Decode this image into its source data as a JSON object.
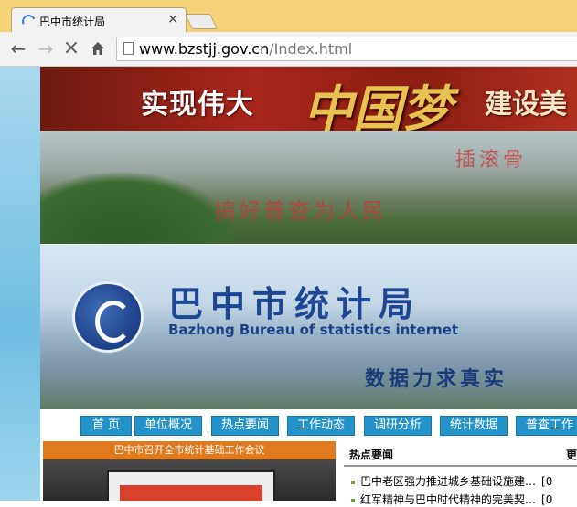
{
  "browser": {
    "tab_title": "巴中市统计局",
    "tab_close": "×",
    "url_host": "www.bzstjj.gov.cn",
    "url_path": "/Index.html"
  },
  "banner": {
    "slogan_left": "实现伟大",
    "slogan_dream": "中国梦",
    "slogan_right": "建设美",
    "calligraphy_right": "插滚骨",
    "calligraphy_left": "搞好普查为人民"
  },
  "header": {
    "title_cn": "巴中市统计局",
    "title_en": "Bazhong Bureau of statistics internet",
    "slogan": "数据力求真实"
  },
  "menu": {
    "items": [
      {
        "label": "首 页"
      },
      {
        "label": "单位概况"
      },
      {
        "label": "热点要闻"
      },
      {
        "label": "工作动态"
      },
      {
        "label": "调研分析"
      },
      {
        "label": "统计数据"
      },
      {
        "label": "普查工作"
      }
    ]
  },
  "news_photo": {
    "caption": "巴中市召开全市统计基础工作会议"
  },
  "hot_news": {
    "title": "热点要闻",
    "more": "更",
    "items": [
      {
        "text": "巴中老区强力推进城乡基础设施建…",
        "tag": "[0"
      },
      {
        "text": "红军精神与巴中时代精神的完美契…",
        "tag": "[0"
      }
    ]
  }
}
